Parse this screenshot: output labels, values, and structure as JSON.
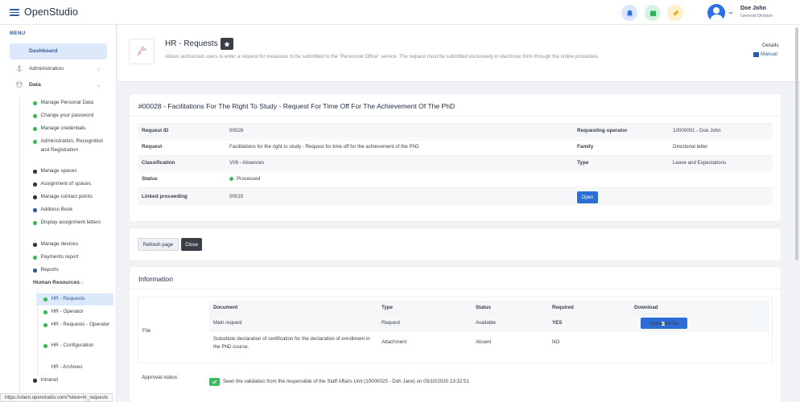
{
  "app": {
    "brand": "OpenStudio"
  },
  "user": {
    "name": "Doe John",
    "role": "General Division"
  },
  "sidebar": {
    "menu_label": "MENU",
    "dashboard": "Dashboard",
    "administration": "Administration",
    "data": "Data",
    "items": [
      {
        "label": "Manage Personal Data",
        "dot": "#3cb95c"
      },
      {
        "label": "Change your password",
        "dot": "#3cb95c"
      },
      {
        "label": "Manage credentials",
        "dot": "#3cb95c"
      },
      {
        "label": "Administration, Recognition and Registration",
        "dot": "#3cb95c"
      },
      {
        "label": "Manage spaces",
        "dot": "#2f3540"
      },
      {
        "label": "Assignment of spaces",
        "dot": "#2f3540"
      },
      {
        "label": "Manage contact points",
        "dot": "#2f3540"
      },
      {
        "label": "Address Book",
        "dot": "#2c5aa0"
      },
      {
        "label": "Display assignment letters",
        "dot": "#3cb95c"
      },
      {
        "label": "Manage devices",
        "dot": "#2f3540"
      },
      {
        "label": "Payments report",
        "dot": "#3cb95c"
      },
      {
        "label": "Reports",
        "dot": "#2c5aa0"
      }
    ],
    "hr_label": "Human Resources",
    "hr_items": [
      {
        "label": "HR - Requests",
        "dot": "#3cb95c"
      },
      {
        "label": "HR - Operator",
        "dot": "#3cb95c"
      },
      {
        "label": "HR - Requests - Operator",
        "dot": "#3cb95c"
      },
      {
        "label": "HR - Configuration",
        "dot": "#3cb95c"
      },
      {
        "label": "HR - Archives",
        "dot": ""
      }
    ],
    "intranet": "Intranet"
  },
  "header": {
    "title": "HR - Requests",
    "description": "Allows authorized users to enter a request for measures to be submitted to the \"Personnel Office\" service. The request must be submitted exclusively in electronic form through the online procedure.",
    "details": "Details",
    "manual": "Manual"
  },
  "request": {
    "title": "#00028 - Facilitations For The Right To Study - Request For Time Off For The Achievement Of The PhD",
    "fields": {
      "id_label": "Request ID",
      "id": "00028",
      "operator_label": "Requesting operator",
      "operator": "10000001 - Doe John",
      "request_label": "Request",
      "request": "Facilitations for the right to study - Request for time off for the achievement of the PhD",
      "family_label": "Family",
      "family": "Directorial letter",
      "class_label": "Classification",
      "class": "VI/6 - Absences",
      "type_label": "Type",
      "type": "Leave and Expectations",
      "status_label": "Status",
      "status": "Processed",
      "linked_label": "Linked proceeding",
      "linked": "00015",
      "open_label": "Open"
    }
  },
  "actions": {
    "refresh": "Refresh page",
    "close": "Close"
  },
  "information": {
    "title": "Information",
    "file_label": "File",
    "columns": [
      "Document",
      "Type",
      "Status",
      "Required",
      "Download"
    ],
    "rows": [
      {
        "document": "Main request",
        "type": "Request",
        "status": "Available",
        "required": "YES",
        "download": "Uploaded file"
      },
      {
        "document": "Substitute declaration of certification for the declaration of enrollment in the PhD course.",
        "type": "Attachment",
        "status": "Absent",
        "required": "NO",
        "download": ""
      }
    ],
    "approval_label": "Approval status",
    "approval_text": "Seen the validation from the responsible of the Staff Affairs Unit (10000025 - Doh Jane) on 05/10/2020 13:32:51"
  },
  "statusbar": {
    "url": "https://client.openstudio.com/?view=hr_requests"
  }
}
